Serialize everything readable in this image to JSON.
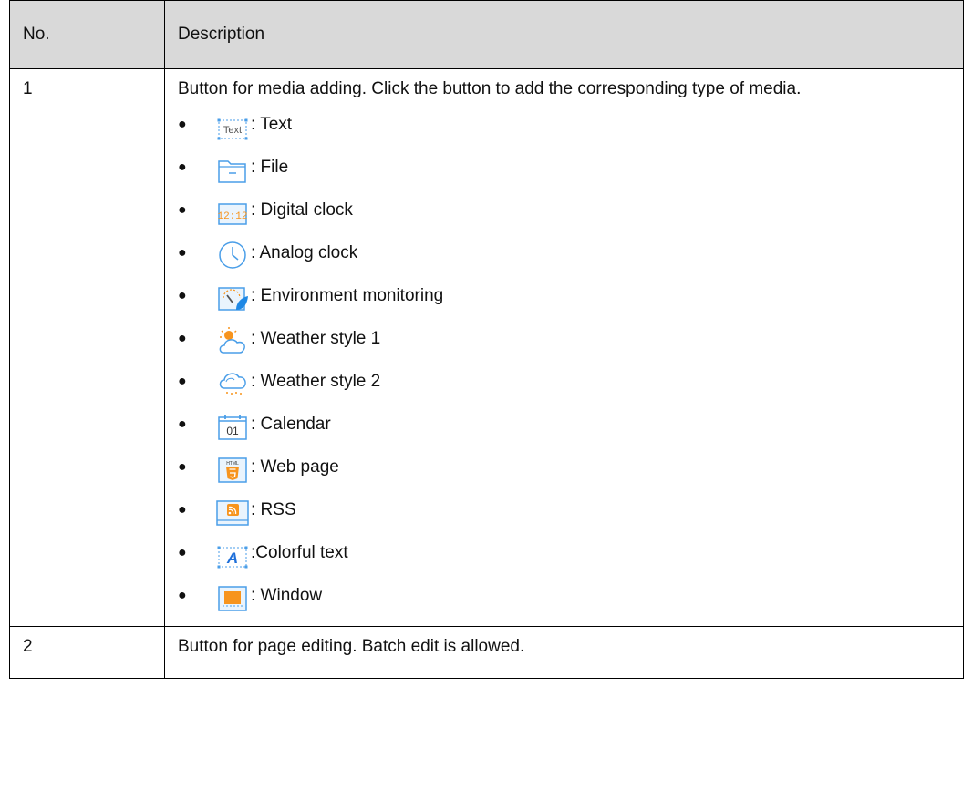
{
  "table": {
    "headers": [
      "No.",
      "Description"
    ],
    "rows": [
      {
        "no": "1",
        "description": "Button for media adding. Click the button to add the corresponding type of media.",
        "media": [
          {
            "icon": "text-icon",
            "icon_text": "Text",
            "label": ": Text"
          },
          {
            "icon": "folder-icon",
            "label": ": File"
          },
          {
            "icon": "digital-clock-icon",
            "icon_text": "12:12",
            "label": ": Digital clock"
          },
          {
            "icon": "analog-clock-icon",
            "label": ": Analog clock"
          },
          {
            "icon": "environment-monitoring-icon",
            "label": ": Environment monitoring"
          },
          {
            "icon": "sun-cloud-icon",
            "label": ": Weather style 1"
          },
          {
            "icon": "cloud-rain-icon",
            "label": ": Weather style 2"
          },
          {
            "icon": "calendar-icon",
            "icon_text": "01",
            "label": ": Calendar"
          },
          {
            "icon": "html5-icon",
            "icon_text": "HTML",
            "label": ": Web page"
          },
          {
            "icon": "rss-icon",
            "label": ": RSS"
          },
          {
            "icon": "colorful-text-icon",
            "icon_text": "A",
            "label": ":Colorful text"
          },
          {
            "icon": "window-icon",
            "label": ": Window"
          }
        ]
      },
      {
        "no": "2",
        "description": "Button for page editing. Batch edit is allowed."
      }
    ]
  },
  "colors": {
    "icon_blue": "#4a9ee8",
    "orange": "#f7941d",
    "header_bg": "#d9d9d9"
  }
}
